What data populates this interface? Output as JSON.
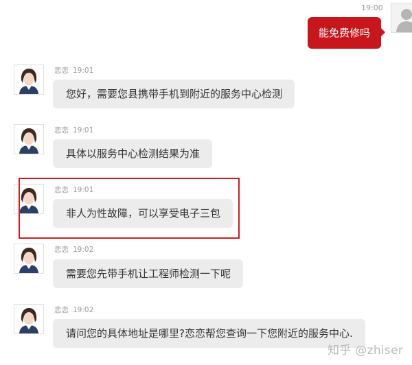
{
  "user_message": {
    "time": "19:00",
    "text": "能免费修吗"
  },
  "agent_messages": [
    {
      "name": "恋恋",
      "time": "19:01",
      "text": "您好，需要您县携带手机到附近的服务中心检测"
    },
    {
      "name": "恋恋",
      "time": "19:01",
      "text": "具体以服务中心检测结果为准"
    },
    {
      "name": "恋恋",
      "time": "19:01",
      "text": "非人为性故障，可以享受电子三包"
    },
    {
      "name": "恋恋",
      "time": "19:02",
      "text": "需要您先带手机让工程师检测一下呢"
    },
    {
      "name": "恋恋",
      "time": "19:02",
      "text": "请问您的具体地址是哪里?恋恋帮您查询一下您附近的服务中心."
    }
  ],
  "watermark": "知乎 @zhiser",
  "colors": {
    "user_bubble": "#c8161d",
    "agent_bubble": "#ececec",
    "highlight": "#d11a1f",
    "meta_text": "#9a9a9a"
  },
  "icons": {
    "user_avatar": "default-user-silhouette",
    "agent_avatar": "agent-photo"
  }
}
